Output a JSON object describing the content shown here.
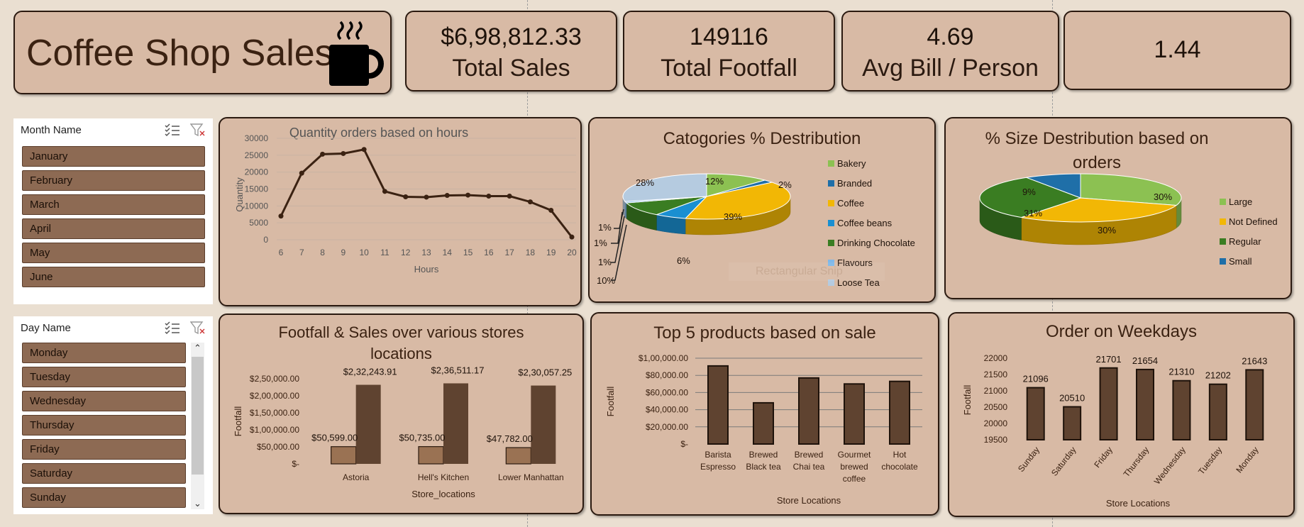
{
  "dashboard": {
    "title": "Coffee Shop Sales",
    "kpis": [
      {
        "value": "$6,98,812.33",
        "label": "Total Sales"
      },
      {
        "value": "149116",
        "label": "Total Footfall"
      },
      {
        "value": "4.69",
        "label": "Avg Bill / Person"
      },
      {
        "value": "1.44",
        "label": ""
      }
    ]
  },
  "slicers": {
    "month": {
      "header": "Month Name",
      "items": [
        "January",
        "February",
        "March",
        "April",
        "May",
        "June"
      ]
    },
    "day": {
      "header": "Day Name",
      "items": [
        "Monday",
        "Tuesday",
        "Wednesday",
        "Thursday",
        "Friday",
        "Saturday",
        "Sunday"
      ]
    }
  },
  "ghost_label": "Rectangular Snip",
  "colors": {
    "panel": "#d8baa5",
    "line": "#3b2212",
    "bar_dark": "#5f4330",
    "bar_light": "#9a7253",
    "pie_green": "#8cc152",
    "pie_navy": "#1f6fa8",
    "pie_gold": "#f2b705",
    "pie_blue": "#1a8fd1",
    "pie_dkgreen": "#3a7d22",
    "pie_sky": "#7fb8e8",
    "pie_pale": "#b5cbe0"
  },
  "chart_data": [
    {
      "type": "line",
      "title": "Quantity orders based on hours",
      "xlabel": "Hours",
      "ylabel": "Quantity",
      "x": [
        6,
        7,
        8,
        9,
        10,
        11,
        12,
        13,
        14,
        15,
        16,
        17,
        18,
        19,
        20
      ],
      "values": [
        7000,
        19700,
        25300,
        25500,
        26700,
        14300,
        12700,
        12600,
        13100,
        13200,
        12900,
        12900,
        11200,
        8700,
        800
      ],
      "ylim": [
        0,
        30000
      ],
      "yticks": [
        0,
        5000,
        10000,
        15000,
        20000,
        25000,
        30000
      ],
      "grid": true
    },
    {
      "type": "pie",
      "title": "Catogories % Destribution",
      "labels": [
        "Bakery",
        "Branded",
        "Coffee",
        "Coffee beans",
        "Drinking Chocolate",
        "Flavours",
        "Loose Tea"
      ],
      "values": [
        12,
        2,
        39,
        6,
        10,
        1,
        28
      ],
      "slice_labels": [
        "12%",
        "2%",
        "39%",
        "6%",
        "10%",
        "1%",
        "28%"
      ],
      "extra_labels": [
        "1%",
        "1%"
      ],
      "legend": "right"
    },
    {
      "type": "pie",
      "title": "% Size Destribution based on orders",
      "labels": [
        "Large",
        "Not Defined",
        "Regular",
        "Small"
      ],
      "values": [
        30,
        30,
        31,
        9
      ],
      "slice_labels": [
        "30%",
        "30%",
        "31%",
        "9%"
      ],
      "legend": "right"
    },
    {
      "type": "bar",
      "title": "Footfall & Sales over various stores locations",
      "xlabel": "Store_locations",
      "ylabel": "Footfall",
      "categories": [
        "Astoria",
        "Hell's Kitchen",
        "Lower Manhattan"
      ],
      "series": [
        {
          "values": [
            50599,
            50735,
            47782
          ],
          "labels": [
            "$50,599.00",
            "$50,735.00",
            "$47,782.00"
          ]
        },
        {
          "values": [
            232243.91,
            236511.17,
            230057.25
          ],
          "labels": [
            "$2,32,243.91",
            "$2,36,511.17",
            "$2,30,057.25"
          ]
        }
      ],
      "ylim": [
        0,
        250000
      ],
      "yticks": [
        "$-",
        "$50,000.00",
        "$1,00,000.00",
        "$1,50,000.00",
        "$2,00,000.00",
        "$2,50,000.00"
      ]
    },
    {
      "type": "bar",
      "title": "Top 5 products based on sale",
      "xlabel": "Store Locations",
      "ylabel": "Footfall",
      "categories": [
        "Barista Espresso",
        "Brewed Black tea",
        "Brewed Chai tea",
        "Gourmet brewed coffee",
        "Hot chocolate"
      ],
      "category_lines": [
        [
          "Barista",
          "Espresso"
        ],
        [
          "Brewed",
          "Black tea"
        ],
        [
          "Brewed",
          "Chai tea"
        ],
        [
          "Gourmet",
          "brewed",
          "coffee"
        ],
        [
          "Hot",
          "chocolate"
        ]
      ],
      "values": [
        91000,
        48000,
        77000,
        70000,
        73000
      ],
      "ylim": [
        0,
        100000
      ],
      "yticks": [
        "$-",
        "$20,000.00",
        "$40,000.00",
        "$60,000.00",
        "$80,000.00",
        "$1,00,000.00"
      ],
      "grid": true
    },
    {
      "type": "bar",
      "title": "Order on Weekdays",
      "xlabel": "Store Locations",
      "ylabel": "Footfall",
      "categories": [
        "Sunday",
        "Saturday",
        "Friday",
        "Thursday",
        "Wednesday",
        "Tuesday",
        "Monday"
      ],
      "values": [
        21096,
        20510,
        21701,
        21654,
        21310,
        21202,
        21643
      ],
      "ylim": [
        19500,
        22000
      ],
      "yticks": [
        19500,
        20000,
        20500,
        21000,
        21500,
        22000
      ]
    }
  ]
}
